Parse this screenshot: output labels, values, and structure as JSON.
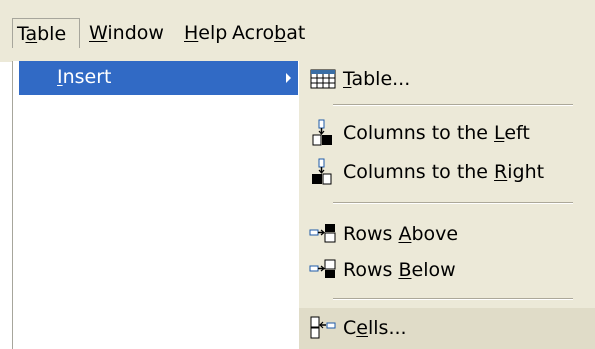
{
  "menubar": {
    "table": {
      "pre": "T",
      "key": "a",
      "post": "ble"
    },
    "window": {
      "pre": "",
      "key": "W",
      "post": "indow"
    },
    "help": {
      "pre": "",
      "key": "H",
      "post": "elp"
    },
    "acrobat": {
      "pre": "Acro",
      "key": "b",
      "post": "at"
    }
  },
  "table_menu": {
    "insert": {
      "pre": "",
      "key": "I",
      "post": "nsert"
    }
  },
  "insert_submenu": {
    "items": [
      {
        "pre": "",
        "key": "T",
        "post": "able...",
        "icon": "table-grid-icon"
      },
      {
        "pre": "Columns to the ",
        "key": "L",
        "post": "eft",
        "icon": "columns-left-icon"
      },
      {
        "pre": "Columns to the ",
        "key": "R",
        "post": "ight",
        "icon": "columns-right-icon"
      },
      {
        "pre": "Rows ",
        "key": "A",
        "post": "bove",
        "icon": "rows-above-icon"
      },
      {
        "pre": "Rows ",
        "key": "B",
        "post": "elow",
        "icon": "rows-below-icon"
      },
      {
        "pre": "C",
        "key": "e",
        "post": "lls...",
        "icon": "cells-icon"
      }
    ]
  },
  "colors": {
    "menu_background": "#ece9d8",
    "highlight": "#316ac5",
    "hover": "#e0dcc8"
  }
}
